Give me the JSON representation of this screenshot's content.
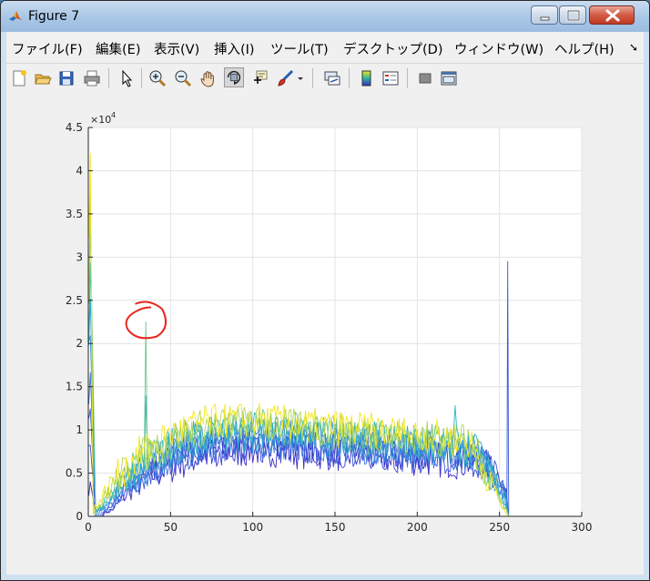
{
  "window": {
    "title": "Figure 7"
  },
  "menu": [
    "ファイル(F)",
    "編集(E)",
    "表示(V)",
    "挿入(I)",
    "ツール(T)",
    "デスクトップ(D)",
    "ウィンドウ(W)",
    "ヘルプ(H)"
  ],
  "toolbar": [
    "new-figure-icon",
    "open-file-icon",
    "save-icon",
    "print-icon",
    "pointer-icon",
    "zoom-in-icon",
    "zoom-out-icon",
    "pan-hand-icon",
    "rotate-3d-icon",
    "data-cursor-icon",
    "brush-icon",
    "link-plot-icon",
    "colorbar-icon",
    "legend-icon",
    "hide-plot-tools-icon",
    "show-plot-tools-icon"
  ],
  "chart_data": {
    "type": "line",
    "title": "",
    "xlabel": "",
    "ylabel": "",
    "exponent_label": "×10",
    "exponent_power": "4",
    "xlim": [
      0,
      300
    ],
    "ylim": [
      0,
      4.5
    ],
    "x_ticks": [
      "0",
      "50",
      "100",
      "150",
      "200",
      "250",
      "300"
    ],
    "y_ticks": [
      "0",
      "0.5",
      "1",
      "1.5",
      "2",
      "2.5",
      "3",
      "3.5",
      "4",
      "4.5"
    ],
    "grid": true,
    "series_count": 10,
    "color_range": [
      "#3a2ac8",
      "#f4e61c"
    ],
    "features": {
      "peak": {
        "x": 35,
        "y": 2.25
      },
      "secondary_peak": {
        "x": 223,
        "y": 1.28
      },
      "right_edge_spike": {
        "x": 255,
        "y": 2.95
      },
      "left_edge_max": {
        "x": 1,
        "y": 4.2
      },
      "plateau_level": [
        0.7,
        1.15
      ],
      "shape_keypoints": [
        [
          0,
          0.05
        ],
        [
          5,
          0.1
        ],
        [
          15,
          0.35
        ],
        [
          30,
          0.6
        ],
        [
          50,
          0.8
        ],
        [
          70,
          0.92
        ],
        [
          100,
          0.95
        ],
        [
          130,
          0.9
        ],
        [
          160,
          0.86
        ],
        [
          200,
          0.8
        ],
        [
          230,
          0.75
        ],
        [
          240,
          0.5
        ],
        [
          250,
          0.15
        ],
        [
          255,
          0.0
        ]
      ]
    },
    "annotation": {
      "shape": "hand-drawn-circle",
      "color": "#e8281e",
      "target_x": 35
    }
  }
}
